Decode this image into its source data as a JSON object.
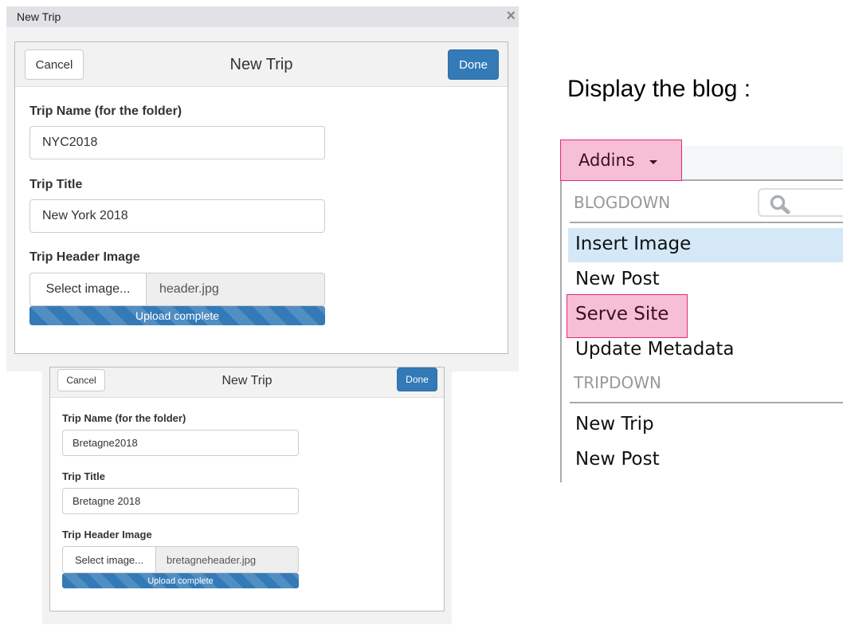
{
  "dialog1": {
    "window_title": "New Trip",
    "close": "×",
    "header_title": "New Trip",
    "cancel": "Cancel",
    "done": "Done",
    "trip_name_label": "Trip Name (for the folder)",
    "trip_name_value": "NYC2018",
    "trip_title_label": "Trip Title",
    "trip_title_value": "New York 2018",
    "header_image_label": "Trip Header Image",
    "select_image": "Select image...",
    "file_name": "header.jpg",
    "upload_status": "Upload complete",
    "upload_progress": 100
  },
  "dialog2": {
    "header_title": "New Trip",
    "cancel": "Cancel",
    "done": "Done",
    "trip_name_label": "Trip Name (for the folder)",
    "trip_name_value": "Bretagne2018",
    "trip_title_label": "Trip Title",
    "trip_title_value": "Bretagne 2018",
    "header_image_label": "Trip Header Image",
    "select_image": "Select image...",
    "file_name": "bretagneheader.jpg",
    "upload_status": "Upload complete",
    "upload_progress": 100
  },
  "caption": "Display the blog :",
  "addins": {
    "label": "Addins",
    "highlight_color": "#f6bfd6",
    "highlight_border": "#e8277a",
    "sections": [
      {
        "title": "BLOGDOWN",
        "items": [
          "Insert Image",
          "New Post",
          "Serve Site",
          "Update Metadata"
        ]
      },
      {
        "title": "TRIPDOWN",
        "items": [
          "New Trip",
          "New Post"
        ]
      }
    ]
  }
}
